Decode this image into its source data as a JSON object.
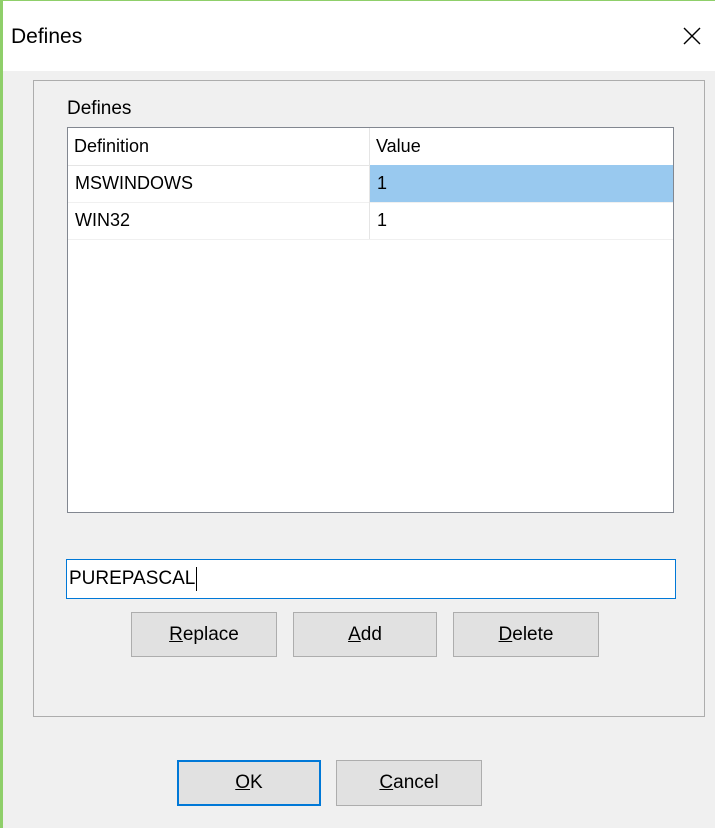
{
  "window": {
    "title": "Defines"
  },
  "group": {
    "label": "Defines"
  },
  "table": {
    "columns": [
      "Definition",
      "Value"
    ],
    "rows": [
      {
        "definition": "MSWINDOWS",
        "value": "1",
        "selected": true
      },
      {
        "definition": "WIN32",
        "value": "1",
        "selected": false
      }
    ]
  },
  "input": {
    "value": "PUREPASCAL"
  },
  "buttons": {
    "replace": {
      "accel": "R",
      "rest": "eplace"
    },
    "add": {
      "accel": "A",
      "rest": "dd"
    },
    "delete": {
      "accel": "D",
      "rest": "elete"
    },
    "ok": {
      "accel": "O",
      "rest": "K"
    },
    "cancel": {
      "accel": "C",
      "rest": "ancel"
    }
  },
  "icons": {
    "close": "close-icon"
  },
  "colors": {
    "selection": "#99c9ef",
    "focus_border": "#0078d7",
    "button_face": "#e1e1e1",
    "window_border": "#8fcf6a"
  }
}
